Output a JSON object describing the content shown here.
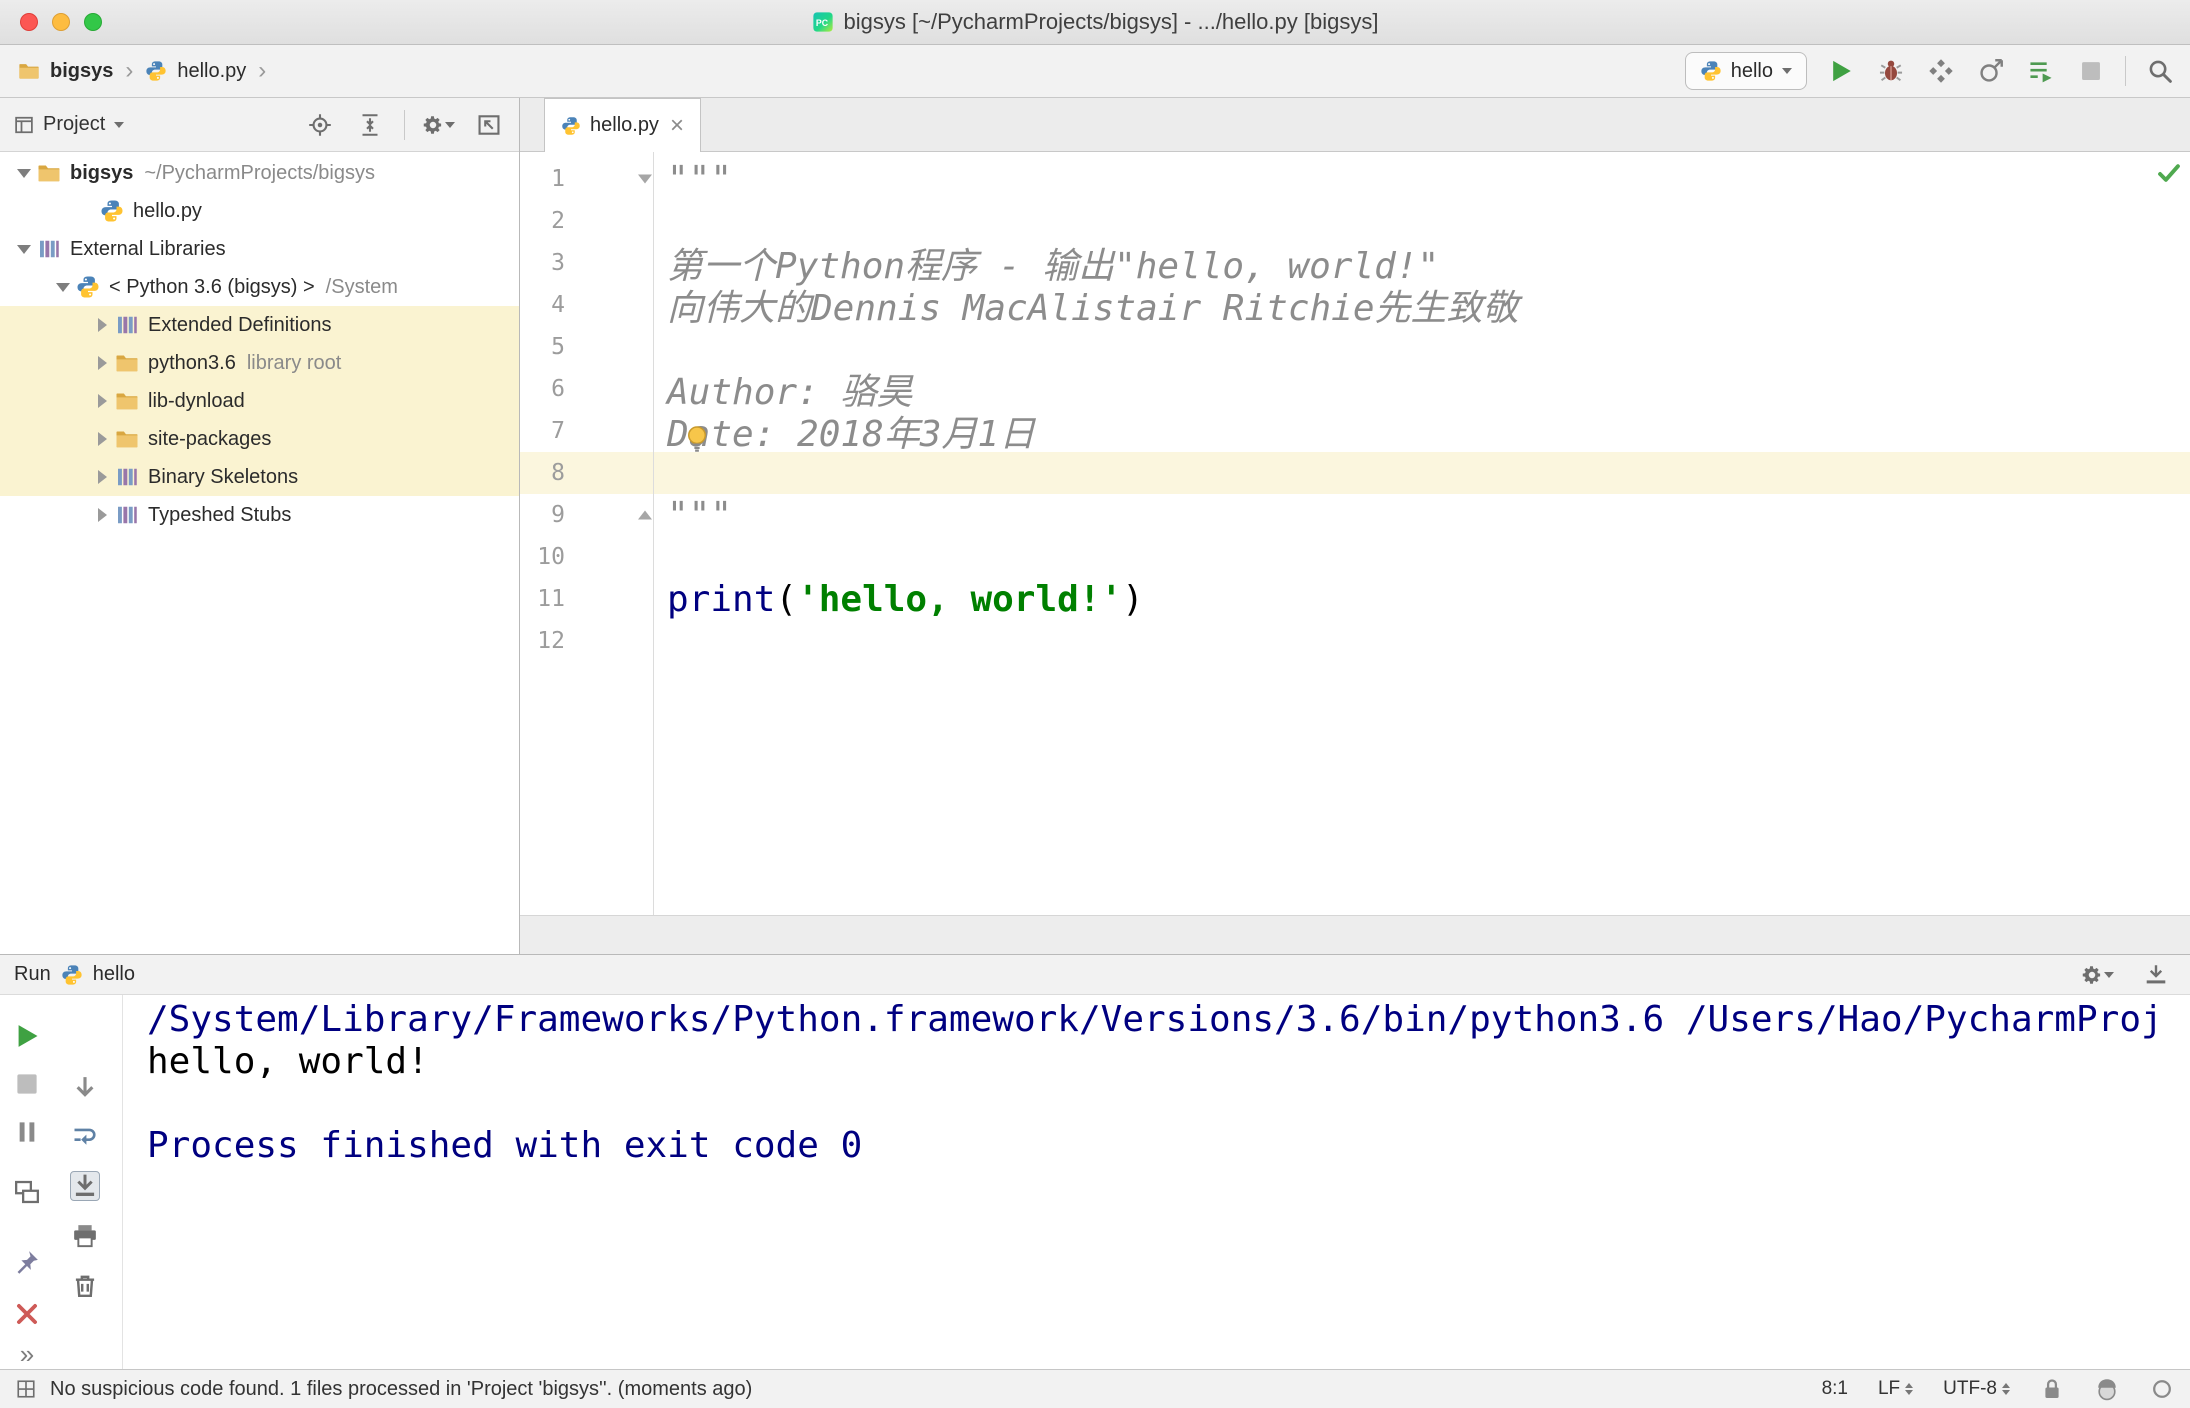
{
  "window": {
    "title": "bigsys [~/PycharmProjects/bigsys] - .../hello.py [bigsys]"
  },
  "navbar": {
    "breadcrumb_project": "bigsys",
    "breadcrumb_file": "hello.py",
    "run_config_label": "hello"
  },
  "project_panel": {
    "title": "Project",
    "tree": [
      {
        "level": 0,
        "arrow": "down",
        "icon": "folder",
        "label": "bigsys",
        "suffix": "~/PycharmProjects/bigsys",
        "bold": true,
        "highlight": false
      },
      {
        "level": 1,
        "arrow": "none",
        "icon": "python",
        "label": "hello.py",
        "highlight": false
      },
      {
        "level": 0,
        "arrow": "down",
        "icon": "library",
        "label": "External Libraries",
        "highlight": false
      },
      {
        "level": 1,
        "arrow": "down",
        "icon": "python",
        "label": "< Python 3.6 (bigsys) >",
        "suffix": "/System",
        "highlight": false
      },
      {
        "level": 2,
        "arrow": "right",
        "icon": "library",
        "label": "Extended Definitions",
        "highlight": true
      },
      {
        "level": 2,
        "arrow": "right",
        "icon": "folder",
        "label": "python3.6",
        "suffix": "library root",
        "highlight": true
      },
      {
        "level": 2,
        "arrow": "right",
        "icon": "folder",
        "label": "lib-dynload",
        "highlight": true
      },
      {
        "level": 2,
        "arrow": "right",
        "icon": "folder",
        "label": "site-packages",
        "highlight": true
      },
      {
        "level": 2,
        "arrow": "right",
        "icon": "library",
        "label": "Binary Skeletons",
        "highlight": true
      },
      {
        "level": 2,
        "arrow": "right",
        "icon": "library",
        "label": "Typeshed Stubs",
        "highlight": false
      }
    ]
  },
  "editor": {
    "tab_label": "hello.py",
    "code_lines": [
      {
        "num": 1,
        "fold": "start",
        "tokens": [
          {
            "t": "\"\"\"",
            "c": "doc"
          }
        ]
      },
      {
        "num": 2,
        "tokens": []
      },
      {
        "num": 3,
        "tokens": [
          {
            "t": "第一个Python程序 - 输出\"hello, world!\"",
            "c": "doc"
          }
        ]
      },
      {
        "num": 4,
        "tokens": [
          {
            "t": "向伟大的Dennis MacAlistair Ritchie先生致敬",
            "c": "doc"
          }
        ]
      },
      {
        "num": 5,
        "tokens": []
      },
      {
        "num": 6,
        "tokens": [
          {
            "t": "Author: 骆昊",
            "c": "doc"
          }
        ]
      },
      {
        "num": 7,
        "tokens": [
          {
            "t": "Date: 2018年3月1日",
            "c": "doc"
          }
        ]
      },
      {
        "num": 8,
        "caret": true,
        "tokens": []
      },
      {
        "num": 9,
        "fold": "end",
        "tokens": [
          {
            "t": "\"\"\"",
            "c": "doc"
          }
        ]
      },
      {
        "num": 10,
        "tokens": []
      },
      {
        "num": 11,
        "tokens": [
          {
            "t": "print",
            "c": "kw"
          },
          {
            "t": "(",
            "c": "plain"
          },
          {
            "t": "'hello, world!'",
            "c": "str"
          },
          {
            "t": ")",
            "c": "plain"
          }
        ]
      },
      {
        "num": 12,
        "tokens": []
      }
    ]
  },
  "run_panel": {
    "title": "Run",
    "config_label": "hello",
    "console_lines": [
      {
        "type": "system",
        "text": "/System/Library/Frameworks/Python.framework/Versions/3.6/bin/python3.6 /Users/Hao/PycharmProj"
      },
      {
        "type": "stdout",
        "text": "hello, world!"
      },
      {
        "type": "stdout",
        "text": ""
      },
      {
        "type": "system",
        "text": "Process finished with exit code 0"
      }
    ]
  },
  "status_bar": {
    "message": "No suspicious code found. 1 files processed in 'Project 'bigsys''. (moments ago)",
    "caret_position": "8:1",
    "line_separator": "LF",
    "encoding": "UTF-8"
  },
  "colors": {
    "accent_green": "#3FA142",
    "keyword": "#000080",
    "string": "#008000",
    "docstring": "#8C8C8C",
    "console_system": "#000080",
    "tree_highlight": "#FAF3D1",
    "caret_line": "#FBF6DE"
  },
  "icons": {
    "navbar": [
      "run",
      "debug",
      "coverage",
      "profiler",
      "running-list",
      "stop",
      "search-everywhere"
    ],
    "project_header": [
      "scroll-from-source",
      "collapse-all",
      "settings",
      "hide-panel"
    ],
    "run_toolbar_left": [
      "rerun",
      "stop",
      "pause-output",
      "show-console",
      "pin-tab",
      "close",
      "more"
    ],
    "run_toolbar_console": [
      "down-stack-trace",
      "soft-wrap",
      "scroll-to-end",
      "print",
      "clear-all"
    ],
    "status_right": [
      "lock",
      "inspector",
      "notifications"
    ]
  }
}
